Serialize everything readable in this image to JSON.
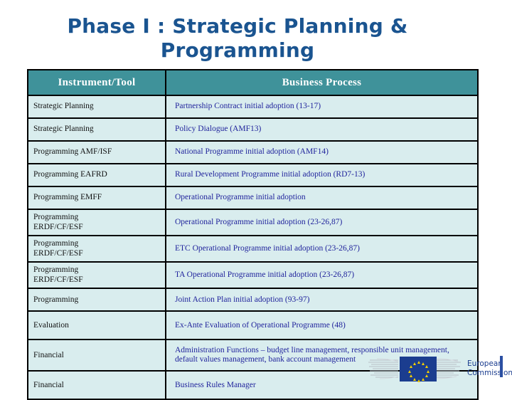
{
  "slide": {
    "title": "Phase I : Strategic Planning &\nProgramming",
    "title_color": "#1a5490"
  },
  "table": {
    "header_bg": "#3f929a",
    "cell_bg": "#d9edee",
    "instrument_text_color": "#111111",
    "process_text_color": "#20239c",
    "columns": [
      {
        "key": "instrument",
        "label": "Instrument/Tool"
      },
      {
        "key": "process",
        "label": "Business Process"
      }
    ],
    "rows": [
      {
        "instrument": "Strategic Planning",
        "process": "Partnership Contract initial adoption (13-17)"
      },
      {
        "instrument": "Strategic Planning",
        "process": "Policy Dialogue (AMF13)"
      },
      {
        "instrument": "Programming AMF/ISF",
        "process": "National Programme initial adoption (AMF14)"
      },
      {
        "instrument": "Programming EAFRD",
        "process": "Rural Development Programme initial adoption (RD7-13)"
      },
      {
        "instrument": "Programming EMFF",
        "process": "Operational Programme initial adoption"
      },
      {
        "instrument": "Programming\nERDF/CF/ESF",
        "process": "Operational Programme initial adoption (23-26,87)"
      },
      {
        "instrument": "Programming\nERDF/CF/ESF",
        "process": "ETC Operational Programme initial adoption (23-26,87)"
      },
      {
        "instrument": "Programming\nERDF/CF/ESF",
        "process": "TA Operational Programme initial adoption (23-26,87)"
      },
      {
        "instrument": "Programming",
        "process": "Joint Action Plan initial adoption (93-97)"
      },
      {
        "instrument": "Evaluation",
        "process": "Ex-Ante Evaluation of Operational Programme (48)"
      },
      {
        "instrument": "Financial",
        "process": "Administration Functions – budget line management, responsible unit management, default values management, bank account management"
      },
      {
        "instrument": "Financial",
        "process": "Business Rules Manager"
      }
    ]
  },
  "logo": {
    "text": "European\nCommission",
    "flag_color": "#1b3d8f",
    "star_color": "#f5d000",
    "text_color": "#1b3d8f",
    "bar_color": "#2b4fa2"
  }
}
